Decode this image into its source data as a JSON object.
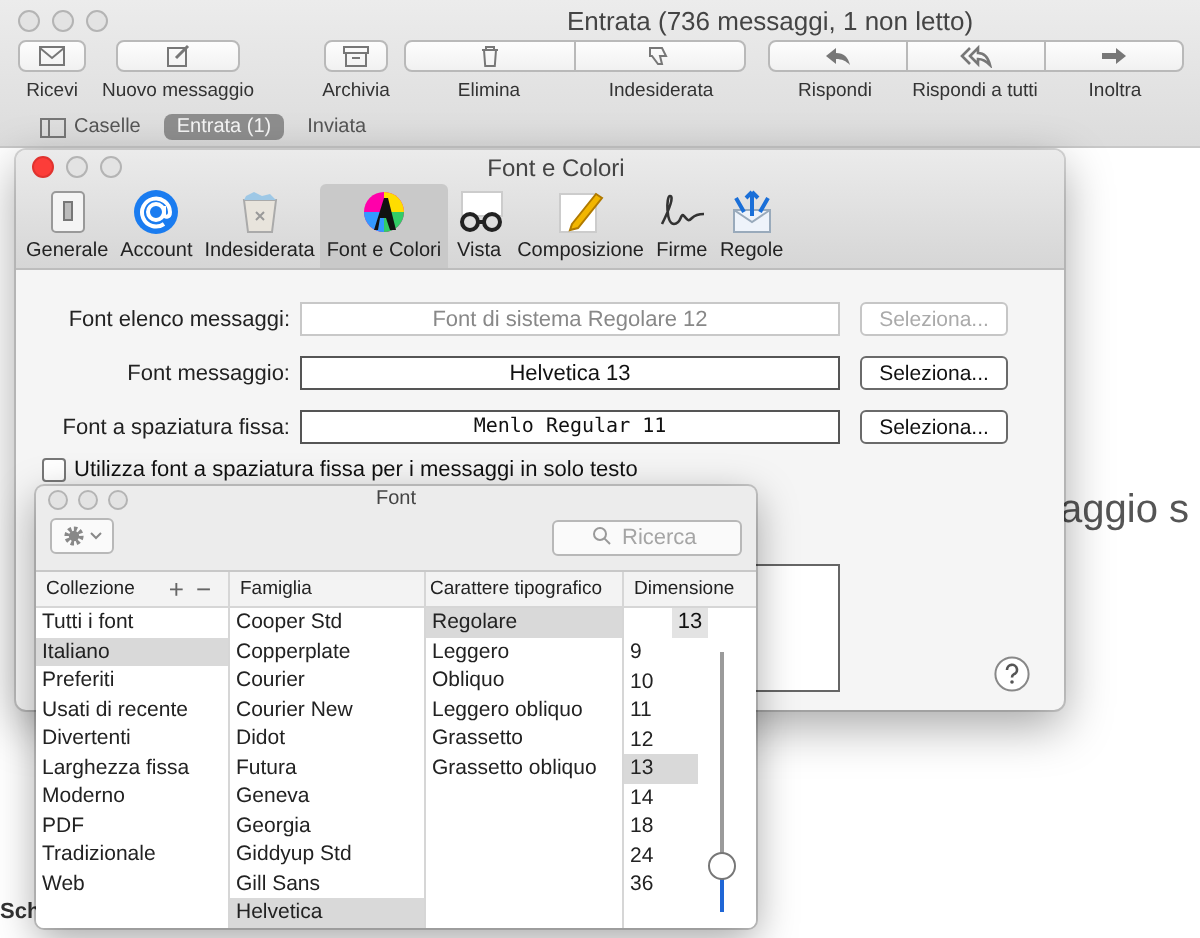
{
  "mail_window": {
    "title": "Entrata (736 messaggi, 1 non letto)",
    "toolbar": [
      {
        "kind": "single",
        "buttons": [
          {
            "label": "Ricevi"
          }
        ]
      },
      {
        "kind": "single",
        "buttons": [
          {
            "label": "Nuovo messaggio"
          }
        ]
      },
      {
        "kind": "single",
        "buttons": [
          {
            "label": "Archivia"
          }
        ]
      },
      {
        "kind": "group",
        "buttons": [
          {
            "label": "Elimina"
          },
          {
            "label": "Indesiderata"
          }
        ]
      },
      {
        "kind": "group",
        "buttons": [
          {
            "label": "Rispondi"
          },
          {
            "label": "Rispondi a tutti"
          },
          {
            "label": "Inoltra"
          }
        ]
      }
    ],
    "tabs": [
      {
        "label": "Caselle",
        "kind": "sidebar",
        "selected": false
      },
      {
        "label": "Entrata (1)",
        "kind": "mailbox",
        "selected": true
      },
      {
        "label": "Inviata",
        "kind": "mailbox",
        "selected": false
      }
    ],
    "message_fragment": "aggio s",
    "list_fragment": "Sch"
  },
  "preferences": {
    "title": "Font e Colori",
    "tabs": [
      {
        "label": "Generale",
        "selected": false
      },
      {
        "label": "Account",
        "selected": false
      },
      {
        "label": "Indesiderata",
        "selected": false
      },
      {
        "label": "Font e Colori",
        "selected": true
      },
      {
        "label": "Vista",
        "selected": false
      },
      {
        "label": "Composizione",
        "selected": false
      },
      {
        "label": "Firme",
        "selected": false
      },
      {
        "label": "Regole",
        "selected": false
      }
    ],
    "fonts": [
      {
        "label": "Font elenco messaggi:",
        "value": "Font di sistema Regolare 12",
        "kind": "system",
        "button": "Seleziona...",
        "disabled": true
      },
      {
        "label": "Font messaggio:",
        "value": "Helvetica 13",
        "kind": "sans",
        "button": "Seleziona...",
        "disabled": false
      },
      {
        "label": "Font a spaziatura fissa:",
        "value": "Menlo Regular 11",
        "kind": "mono",
        "button": "Seleziona...",
        "disabled": false
      }
    ],
    "checkbox": {
      "label": "Utilizza font a spaziatura fissa per i messaggi in solo testo",
      "checked": false
    }
  },
  "font_panel": {
    "title": "Font",
    "search": {
      "placeholder": "Ricerca"
    },
    "collection_buttons": [
      "+",
      "−"
    ],
    "columns": [
      "Collezione",
      "Famiglia",
      "Carattere tipografico",
      "Dimensione"
    ],
    "collections": [
      {
        "label": "Tutti i font",
        "selected": false
      },
      {
        "label": "Italiano",
        "selected": true
      },
      {
        "label": "Preferiti",
        "selected": false
      },
      {
        "label": "Usati di recente",
        "selected": false
      },
      {
        "label": "Divertenti",
        "selected": false
      },
      {
        "label": "Larghezza fissa",
        "selected": false
      },
      {
        "label": "Moderno",
        "selected": false
      },
      {
        "label": "PDF",
        "selected": false
      },
      {
        "label": "Tradizionale",
        "selected": false
      },
      {
        "label": "Web",
        "selected": false
      }
    ],
    "families": [
      {
        "label": "Cooper Std",
        "selected": false
      },
      {
        "label": "Copperplate",
        "selected": false
      },
      {
        "label": "Courier",
        "selected": false
      },
      {
        "label": "Courier New",
        "selected": false
      },
      {
        "label": "Didot",
        "selected": false
      },
      {
        "label": "Futura",
        "selected": false
      },
      {
        "label": "Geneva",
        "selected": false
      },
      {
        "label": "Georgia",
        "selected": false
      },
      {
        "label": "Giddyup Std",
        "selected": false
      },
      {
        "label": "Gill Sans",
        "selected": false
      },
      {
        "label": "Helvetica",
        "selected": true
      }
    ],
    "typefaces": [
      {
        "label": "Regolare",
        "selected": true
      },
      {
        "label": "Leggero",
        "selected": false
      },
      {
        "label": "Obliquo",
        "selected": false
      },
      {
        "label": "Leggero obliquo",
        "selected": false
      },
      {
        "label": "Grassetto",
        "selected": false
      },
      {
        "label": "Grassetto obliquo",
        "selected": false
      }
    ],
    "size_value": "13",
    "sizes": [
      {
        "label": "9",
        "selected": false
      },
      {
        "label": "10",
        "selected": false
      },
      {
        "label": "11",
        "selected": false
      },
      {
        "label": "12",
        "selected": false
      },
      {
        "label": "13",
        "selected": true
      },
      {
        "label": "14",
        "selected": false
      },
      {
        "label": "18",
        "selected": false
      },
      {
        "label": "24",
        "selected": false
      },
      {
        "label": "36",
        "selected": false
      }
    ],
    "size_slider": {
      "level": 0.18
    }
  }
}
